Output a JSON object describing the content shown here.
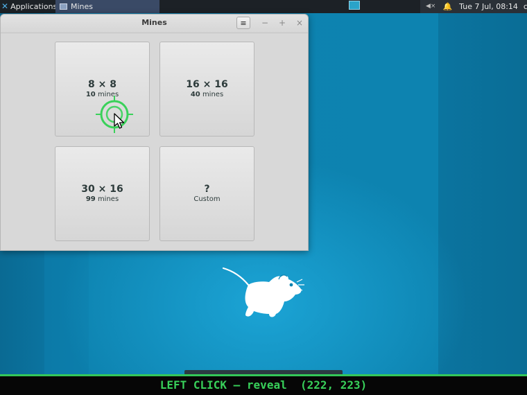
{
  "taskbar": {
    "apps_label": "Applications",
    "task_title": "Mines",
    "clock": "Tue  7 Jul, 08:14",
    "user": "cua"
  },
  "icons": {
    "apps": "xfce-icon",
    "task": "window-icon",
    "volume": "volume-muted-icon",
    "notifications": "bell-icon",
    "menu": "hamburger-menu-icon",
    "minimize": "minimize-icon",
    "maximize": "maximize-icon",
    "close": "close-icon",
    "cursor": "mouse-pointer-icon",
    "click": "crosshair-icon",
    "wallpaper": "xfce-mouse-logo"
  },
  "window": {
    "title": "Mines",
    "minimize": "−",
    "maximize": "+",
    "close": "×",
    "menu": "≡"
  },
  "options": [
    {
      "size": "8 × 8",
      "count": "10",
      "unit": "mines"
    },
    {
      "size": "16 × 16",
      "count": "40",
      "unit": "mines"
    },
    {
      "size": "30 × 16",
      "count": "99",
      "unit": "mines"
    },
    {
      "size": "?",
      "label": "Custom"
    }
  ],
  "status": {
    "text": "LEFT CLICK — reveal  (222, 223)"
  },
  "colors": {
    "accent": "#38d05a",
    "desktop": "#0d83b0",
    "panel": "#1c2126"
  }
}
